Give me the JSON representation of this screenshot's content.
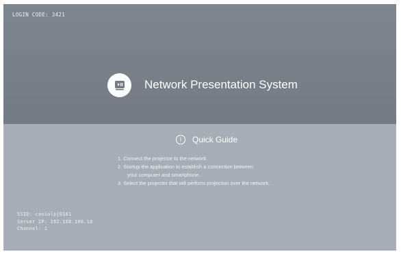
{
  "login": {
    "label": "LOGIN CODE",
    "code": "3421",
    "text": "LOGIN CODE: 3421"
  },
  "brand": {
    "title": "Network Presentation System",
    "logo_icon": "projector-play-pause-icon"
  },
  "guide": {
    "title": "Quick Guide",
    "icon": "info-icon",
    "icon_glyph": "i",
    "steps": [
      "1. Connect the projector to the network.",
      "2. Startup the application to establish a connection between",
      "your computer and smartphone.",
      "3. Select the projector that will perform projection over the network."
    ]
  },
  "network": {
    "ssid": "SSID: casiolpj0161",
    "server_ip": "Server IP: 192.168.100.10",
    "channel": "Channel: 1"
  },
  "colors": {
    "top_panel": "#7a828b",
    "bottom_panel": "#a6adb6",
    "text": "#ffffff",
    "logo_glyph": "#737b85"
  }
}
